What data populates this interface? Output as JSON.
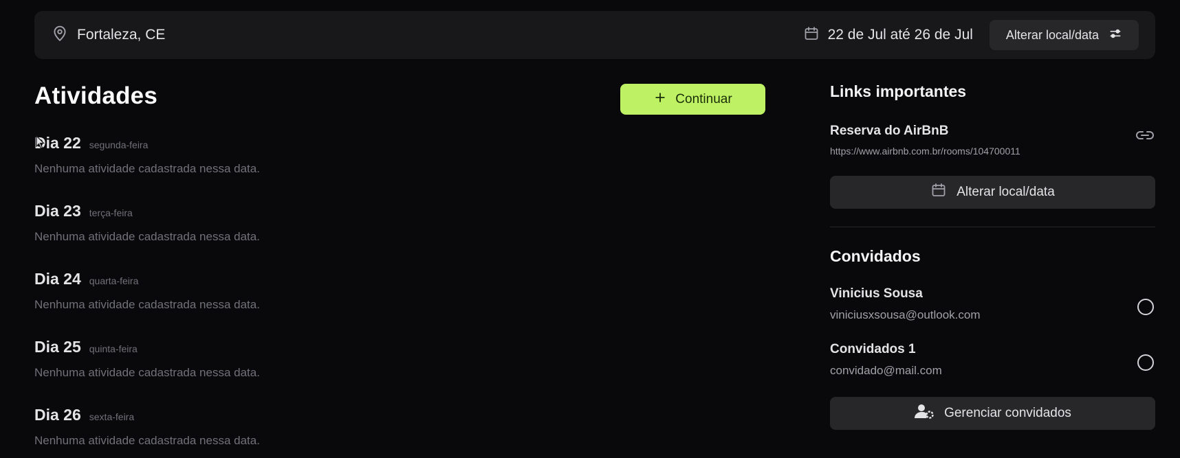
{
  "header": {
    "location": "Fortaleza, CE",
    "dates": "22 de Jul até 26 de Jul",
    "change_button": "Alterar local/data"
  },
  "activities": {
    "title": "Atividades",
    "continue_button": "Continuar",
    "days": [
      {
        "name": "Dia 22",
        "weekday": "segunda-feira",
        "empty": "Nenhuma atividade cadastrada nessa data."
      },
      {
        "name": "Dia 23",
        "weekday": "terça-feira",
        "empty": "Nenhuma atividade cadastrada nessa data."
      },
      {
        "name": "Dia 24",
        "weekday": "quarta-feira",
        "empty": "Nenhuma atividade cadastrada nessa data."
      },
      {
        "name": "Dia 25",
        "weekday": "quinta-feira",
        "empty": "Nenhuma atividade cadastrada nessa data."
      },
      {
        "name": "Dia 26",
        "weekday": "sexta-feira",
        "empty": "Nenhuma atividade cadastrada nessa data."
      }
    ]
  },
  "links": {
    "title": "Links importantes",
    "items": [
      {
        "title": "Reserva do AirBnB",
        "url": "https://www.airbnb.com.br/rooms/104700011"
      }
    ],
    "change_button": "Alterar local/data"
  },
  "guests": {
    "title": "Convidados",
    "items": [
      {
        "name": "Vinicius Sousa",
        "email": "viniciusxsousa@outlook.com"
      },
      {
        "name": "Convidados 1",
        "email": "convidado@mail.com"
      }
    ],
    "manage_button": "Gerenciar convidados"
  },
  "colors": {
    "background": "#09090b",
    "surface": "#18181b",
    "button_secondary": "#27272a",
    "accent": "#bef264"
  },
  "icons": [
    "map-pin-icon",
    "calendar-icon",
    "settings-sliders-icon",
    "plus-icon",
    "link-icon",
    "circle-icon",
    "user-cog-icon",
    "mouse-cursor-icon"
  ]
}
